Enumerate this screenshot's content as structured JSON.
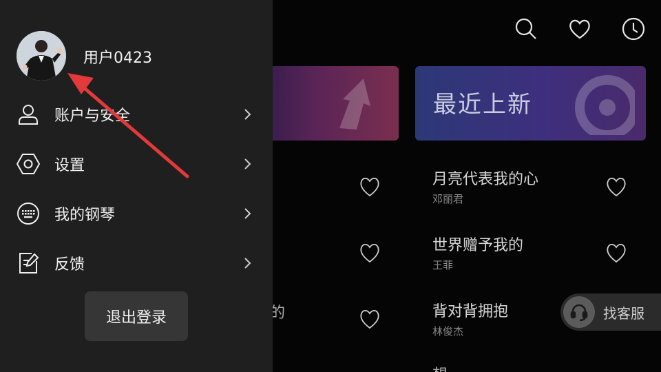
{
  "header": {
    "icons": [
      "search-icon",
      "heart-icon",
      "history-icon"
    ]
  },
  "banners": {
    "right_title": "最近上新"
  },
  "songs": {
    "right": [
      {
        "title": "月亮代表我的心",
        "artist": "邓丽君"
      },
      {
        "title": "世界赠予我的",
        "artist": "王菲"
      },
      {
        "title": "背对背拥抱",
        "artist": "林俊杰"
      }
    ],
    "left_partial_char": "的",
    "bottom_cut_char": "想"
  },
  "service": {
    "label": "找客服"
  },
  "drawer": {
    "username": "用户0423",
    "menu": [
      {
        "label": "账户与安全",
        "icon": "user-icon"
      },
      {
        "label": "设置",
        "icon": "hexagon-settings-icon"
      },
      {
        "label": "我的钢琴",
        "icon": "keyboard-icon"
      },
      {
        "label": "反馈",
        "icon": "feedback-edit-icon"
      }
    ],
    "logout_label": "退出登录"
  },
  "colors": {
    "drawer_bg": "#1f1f1f",
    "annotation_arrow": "#e23a3a"
  }
}
